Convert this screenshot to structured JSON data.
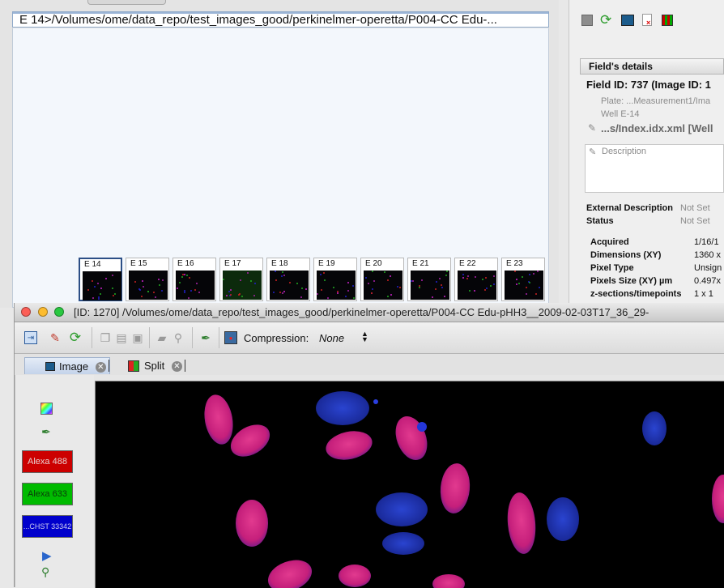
{
  "well_browser": {
    "path": "E 14>/Volumes/ome/data_repo/test_images_good/perkinelmer-operetta/P004-CC Edu-...",
    "thumbnails": [
      "E 14",
      "E 15",
      "E 16",
      "E 17",
      "E 18",
      "E 19",
      "E 20",
      "E 21",
      "E 22",
      "E 23"
    ],
    "selected_thumbnail": "E 14"
  },
  "field_details": {
    "header": "Field's details",
    "title": "Field ID: 737 (Image ID: 1",
    "plate": "Plate: ...Measurement1/Ima",
    "well": "Well E-14",
    "file": "...s/Index.idx.xml [Well",
    "description_placeholder": "Description",
    "external_description_label": "External Description",
    "external_description_value": "Not Set",
    "status_label": "Status",
    "status_value": "Not Set",
    "acquired_label": "Acquired",
    "acquired_value": "1/16/1",
    "dimensions_label": "Dimensions (XY)",
    "dimensions_value": "1360 x",
    "pixel_type_label": "Pixel Type",
    "pixel_type_value": "Unsign",
    "pixel_size_label": "Pixels Size (XY) µm",
    "pixel_size_value": "0.497x",
    "zsections_label": "z-sections/timepoints",
    "zsections_value": "1 x 1"
  },
  "viewer": {
    "title": "[ID: 1270] /Volumes/ome/data_repo/test_images_good/perkinelmer-operetta/P004-CC Edu-pHH3__2009-02-03T17_36_29-",
    "compression_label": "Compression:",
    "compression_value": "None",
    "tabs": [
      {
        "label": "Image",
        "active": true
      },
      {
        "label": "Split",
        "active": false
      }
    ],
    "channels": [
      {
        "label": "Alexa 488",
        "color": "#cc0000"
      },
      {
        "label": "Alexa 633",
        "color": "#00bb00"
      },
      {
        "label": "...CHST 33342",
        "color": "#0000cc"
      }
    ]
  },
  "icons": {
    "right_toolbar": [
      "grid-icon",
      "refresh-icon",
      "image-viewer-icon",
      "delete-icon",
      "heatmap-icon"
    ],
    "viewer_toolbar": [
      "export-icon",
      "edit-icon",
      "refresh-icon",
      "copy-icon",
      "paste-icon",
      "save-icon",
      "movie-icon",
      "zoom-icon",
      "pipette-icon",
      "compression-icon"
    ],
    "side_tools": [
      "color-picker-icon",
      "pipette-icon",
      "play-icon",
      "zoom-icon"
    ]
  },
  "colors": {
    "selection_border": "#2c4f86",
    "nuclei_pink": "#d0207f",
    "nuclei_blue": "#1a2fb0"
  }
}
